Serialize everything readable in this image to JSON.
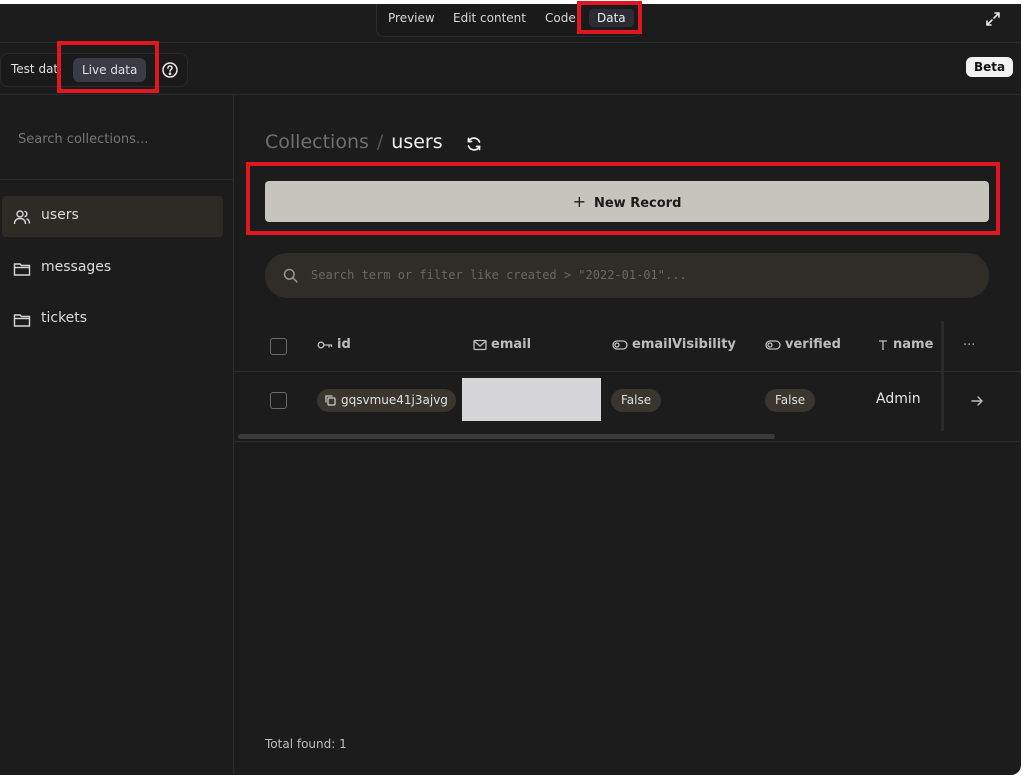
{
  "modes": {
    "preview": "Preview",
    "edit_content": "Edit content",
    "code": "Code",
    "data": "Data"
  },
  "toolbar": {
    "test_data": "Test dat",
    "live_data": "Live data",
    "beta": "Beta"
  },
  "sidebar": {
    "search_placeholder": "Search collections...",
    "collections": [
      {
        "label": "users",
        "icon": "users-icon"
      },
      {
        "label": "messages",
        "icon": "folder-icon"
      },
      {
        "label": "tickets",
        "icon": "folder-icon"
      }
    ]
  },
  "breadcrumb": {
    "root": "Collections",
    "separator": "/",
    "current": "users"
  },
  "new_record_label": "New Record",
  "filter_placeholder": "Search term or filter like created > \"2022-01-01\"...",
  "table": {
    "columns": {
      "id": "id",
      "email": "email",
      "email_visibility": "emailVisibility",
      "verified": "verified",
      "name": "name",
      "more": "···"
    },
    "rows": [
      {
        "id": "gqsvmue41j3ajvg",
        "email_visibility": "False",
        "verified": "False",
        "name": "Admin"
      }
    ]
  },
  "footer": {
    "total": "Total found: 1"
  },
  "colors": {
    "highlight": "#e0171e",
    "background": "#1c1c1c",
    "button": "#c5c4bd"
  }
}
